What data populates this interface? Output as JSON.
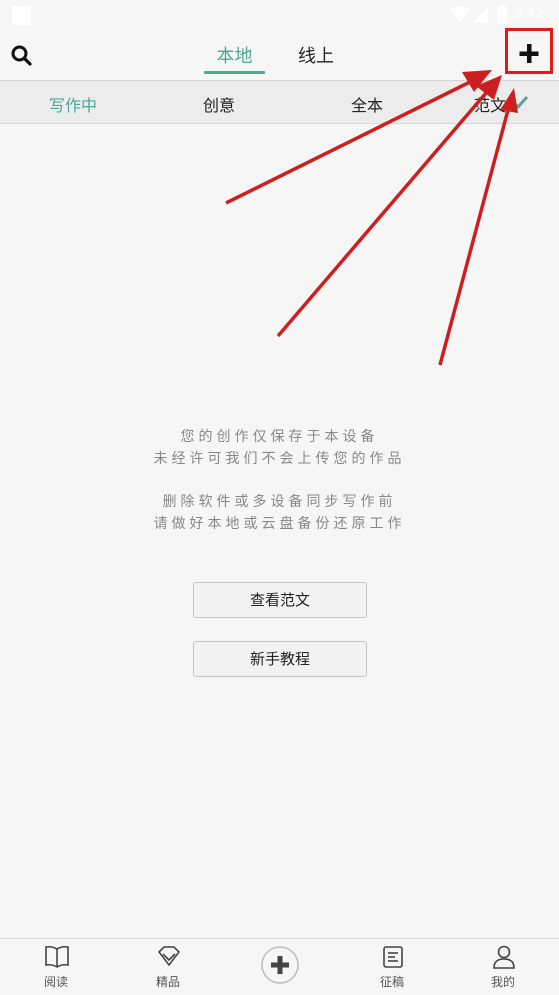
{
  "status_bar": {
    "time": "3:42"
  },
  "header": {
    "tabs": [
      {
        "label": "本地",
        "active": true
      },
      {
        "label": "线上",
        "active": false
      }
    ]
  },
  "subtabs": [
    {
      "label": "写作中",
      "active": true
    },
    {
      "label": "创意",
      "active": false
    },
    {
      "label": "全本",
      "active": false
    },
    {
      "label": "范文",
      "active": false
    }
  ],
  "main": {
    "info_lines_1": [
      "您的创作仅保存于本设备",
      "未经许可我们不会上传您的作品"
    ],
    "info_lines_2": [
      "删除软件或多设备同步写作前",
      "请做好本地或云盘备份还原工作"
    ],
    "view_samples_label": "查看范文",
    "tutorial_label": "新手教程"
  },
  "bottom_nav": [
    {
      "label": "阅读",
      "icon": "book-icon"
    },
    {
      "label": "精品",
      "icon": "diamond-icon"
    },
    {
      "label": "",
      "icon": "plus-circle-icon"
    },
    {
      "label": "征稿",
      "icon": "document-icon"
    },
    {
      "label": "我的",
      "icon": "user-icon"
    }
  ],
  "colors": {
    "accent": "#4ea797",
    "annotation": "#e01b1b"
  }
}
